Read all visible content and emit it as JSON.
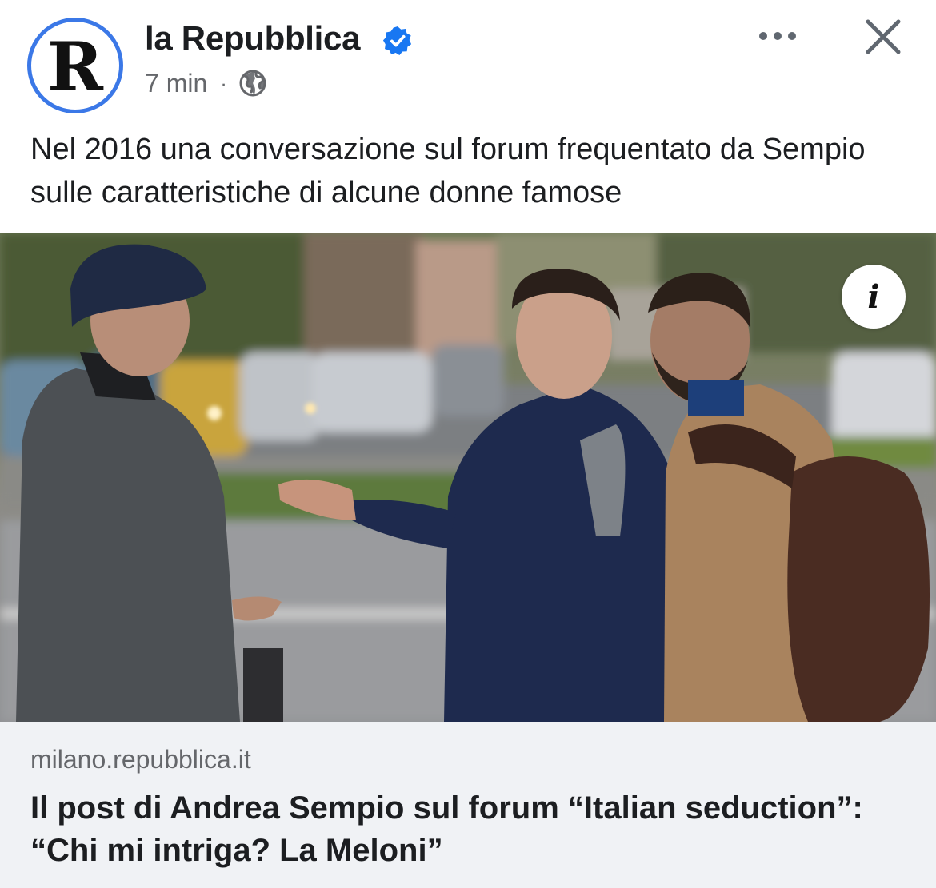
{
  "post": {
    "author": "la Repubblica",
    "avatar_letter": "R",
    "time": "7 min",
    "separator": "·",
    "caption": "Nel 2016 una conversazione sul forum frequentato da Sempio sulle caratteristiche di alcune donne famose"
  },
  "icons": {
    "verified": "verified-badge-icon",
    "audience": "globe-icon",
    "more": "more-options-icon",
    "close": "close-icon",
    "info": "info-icon"
  },
  "colors": {
    "verified_blue": "#1877f2",
    "avatar_ring": "#3b78e7",
    "card_background": "#f0f2f5",
    "secondary_text": "#65676b"
  },
  "image": {
    "info_glyph": "i"
  },
  "link": {
    "domain": "milano.repubblica.it",
    "title": "Il post di Andrea Sempio sul forum “Italian seduction”: “Chi mi intriga? La Meloni”"
  }
}
